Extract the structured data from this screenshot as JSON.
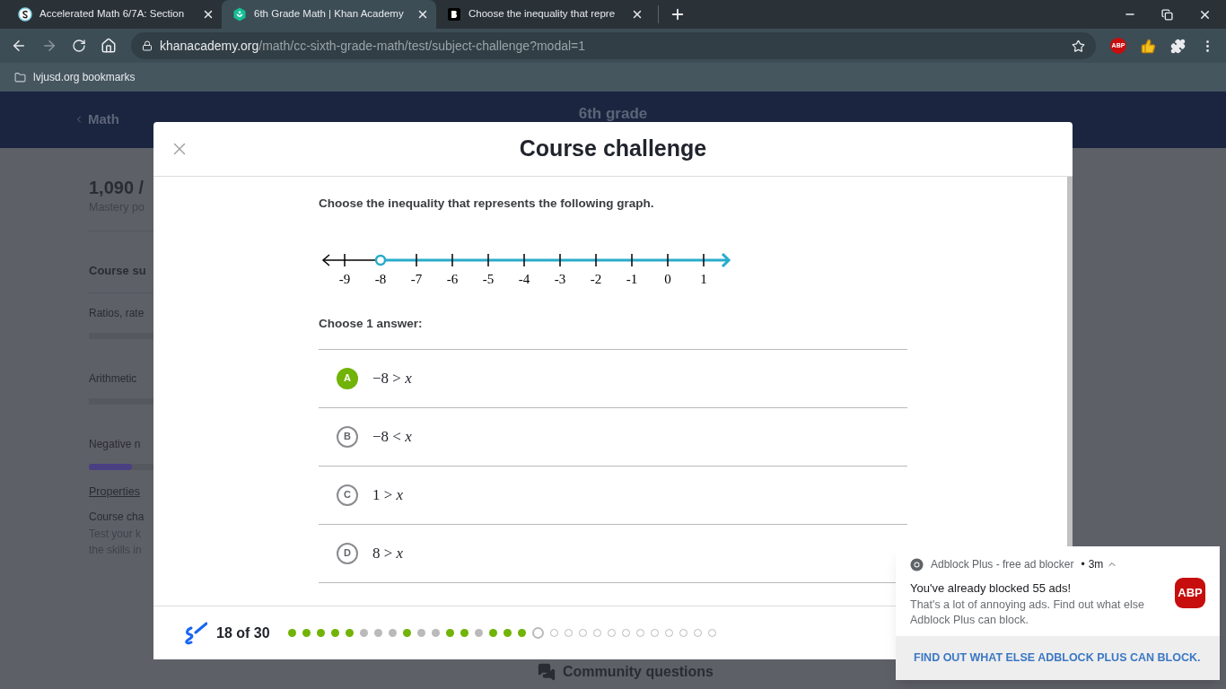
{
  "browser": {
    "tabs": [
      {
        "title": "Accelerated Math 6/7A: Section",
        "selected": false
      },
      {
        "title": "6th Grade Math | Khan Academy",
        "selected": true
      },
      {
        "title": "Choose the inequality that repre",
        "selected": false
      }
    ],
    "address": {
      "host": "khanacademy.org",
      "path": "/math/cc-sixth-grade-math/test/subject-challenge?modal=1"
    },
    "extension_badge": "ABP",
    "bookmarks": [
      {
        "label": "lvjusd.org bookmarks"
      }
    ]
  },
  "page": {
    "back_link": "Math",
    "header_title": "6th grade",
    "points": "1,090 /",
    "points_label": "Mastery po",
    "course_summary": "Course su",
    "units": [
      {
        "name": "Ratios, rate"
      },
      {
        "name": "Arithmetic"
      },
      {
        "name": "Negative n",
        "level": 0.66
      }
    ],
    "properties": "Properties",
    "challenge_title": "Course cha",
    "challenge_lines": [
      "Test your k",
      "the skills in"
    ],
    "community": "Community questions"
  },
  "modal": {
    "title": "Course challenge",
    "question": "Choose the inequality that represents the following graph.",
    "number_line": {
      "kind": "ray_right",
      "ticks": [
        {
          "label": "-9",
          "open_circle": false
        },
        {
          "label": "-8",
          "open_circle": true
        },
        {
          "label": "-7",
          "open_circle": false
        },
        {
          "label": "-6",
          "open_circle": false
        },
        {
          "label": "-5",
          "open_circle": false
        },
        {
          "label": "-4",
          "open_circle": false
        },
        {
          "label": "-3",
          "open_circle": false
        },
        {
          "label": "-2",
          "open_circle": false
        },
        {
          "label": "-1",
          "open_circle": false
        },
        {
          "label": "0",
          "open_circle": false
        },
        {
          "label": "1",
          "open_circle": false
        }
      ]
    },
    "prompt": "Choose 1 answer:",
    "choices": [
      {
        "letter": "A",
        "text": "−8 > *x*",
        "selected": true
      },
      {
        "letter": "B",
        "text": "−8 < *x*",
        "selected": false
      },
      {
        "letter": "C",
        "text": "1 > *x*",
        "selected": false
      },
      {
        "letter": "D",
        "text": "8 > *x*",
        "selected": false
      }
    ],
    "progress": {
      "label": "18 of 30",
      "dots": [
        {
          "kind": "correct"
        },
        {
          "kind": "correct"
        },
        {
          "kind": "correct"
        },
        {
          "kind": "correct"
        },
        {
          "kind": "correct"
        },
        {
          "kind": "incorrect"
        },
        {
          "kind": "incorrect"
        },
        {
          "kind": "incorrect"
        },
        {
          "kind": "correct"
        },
        {
          "kind": "incorrect"
        },
        {
          "kind": "incorrect"
        },
        {
          "kind": "correct"
        },
        {
          "kind": "correct"
        },
        {
          "kind": "incorrect"
        },
        {
          "kind": "correct"
        },
        {
          "kind": "correct"
        },
        {
          "kind": "correct"
        },
        {
          "kind": "current"
        },
        {
          "kind": "unanswered"
        },
        {
          "kind": "unanswered"
        },
        {
          "kind": "unanswered"
        },
        {
          "kind": "unanswered"
        },
        {
          "kind": "unanswered"
        },
        {
          "kind": "unanswered"
        },
        {
          "kind": "unanswered"
        },
        {
          "kind": "unanswered"
        },
        {
          "kind": "unanswered"
        },
        {
          "kind": "unanswered"
        },
        {
          "kind": "unanswered"
        },
        {
          "kind": "unanswered"
        }
      ]
    }
  },
  "notification": {
    "source": "Adblock Plus - free ad blocker",
    "separator": "•",
    "time": "3m",
    "title": "You've already blocked 55 ads!",
    "body": "That's a lot of annoying ads. Find out what else Adblock Plus can block.",
    "logo_text": "ABP",
    "action": "FIND OUT WHAT ELSE ADBLOCK PLUS CAN BLOCK."
  }
}
